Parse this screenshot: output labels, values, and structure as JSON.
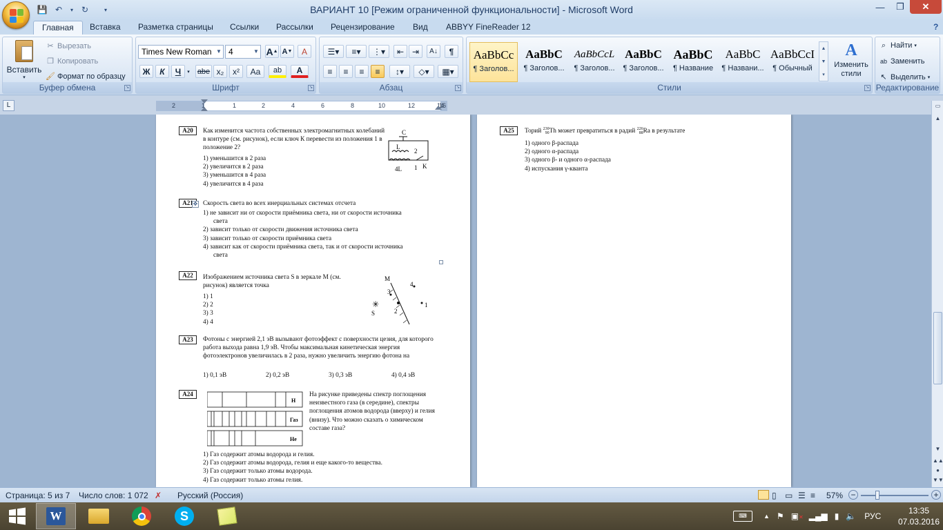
{
  "window": {
    "title": "ВАРИАНТ 10 [Режим ограниченной функциональности] - Microsoft Word",
    "minimize": "—",
    "maximize": "❐",
    "close": "✕",
    "help": "?"
  },
  "qat": [
    "💾",
    "↶",
    "▾",
    "↻",
    "▾"
  ],
  "tabs": [
    "Главная",
    "Вставка",
    "Разметка страницы",
    "Ссылки",
    "Рассылки",
    "Рецензирование",
    "Вид",
    "ABBYY FineReader 12"
  ],
  "ribbon": {
    "clipboard": {
      "label": "Буфер обмена",
      "paste": "Вставить",
      "cut": "Вырезать",
      "copy": "Копировать",
      "format_painter": "Формат по образцу"
    },
    "font": {
      "label": "Шрифт",
      "font_name": "Times New Roman",
      "font_size": "4",
      "grow": "A",
      "shrink": "A",
      "clear": "A",
      "bold": "Ж",
      "italic": "К",
      "underline": "Ч",
      "strike": "abe",
      "sub": "x₂",
      "sup": "x²",
      "case": "Aa",
      "highlight": "ab",
      "color": "A"
    },
    "paragraph": {
      "label": "Абзац"
    },
    "styles": {
      "label": "Стили",
      "change": "Изменить стили",
      "items": [
        {
          "preview": "AaBbCc",
          "name": "¶ Заголов..."
        },
        {
          "preview": "AaBbC",
          "name": "¶ Заголов..."
        },
        {
          "preview": "AaBbCcL",
          "name": "¶ Заголов..."
        },
        {
          "preview": "AaBbC",
          "name": "¶ Заголов..."
        },
        {
          "preview": "AaBbC",
          "name": "¶ Название"
        },
        {
          "preview": "AaBbC",
          "name": "¶ Названи..."
        },
        {
          "preview": "AaBbCcI",
          "name": "¶ Обычный"
        }
      ]
    },
    "editing": {
      "label": "Редактирование",
      "find": "Найти",
      "replace": "Заменить",
      "select": "Выделить"
    }
  },
  "ruler": {
    "corner": "L",
    "ticks": [
      "2",
      "1",
      "1",
      "2",
      "4",
      "6",
      "8",
      "10",
      "12",
      "14",
      "16"
    ]
  },
  "page1": {
    "a20": {
      "num": "A20",
      "text": "Как изменится частота собственных электромагнитных колебаний в контуре (см. рисунок), если ключ К перевести из положения 1 в положение 2?",
      "options": [
        "1)  уменьшится в 2 раза",
        "2)  увеличится в 2 раза",
        "3)  уменьшится в 4 раза",
        "4)  увеличится в 4 раза"
      ],
      "fig": {
        "c": "C",
        "l": "L",
        "l4": "4L",
        "p1": "1",
        "p2": "2",
        "k": "K"
      }
    },
    "a21": {
      "num": "A21",
      "text": "Скорость света во всех инерциальных системах отсчета",
      "options": [
        "1)  не зависит ни от скорости приёмника света, ни от скорости источника",
        "света",
        "2)  зависит только от скорости движения источника света",
        "3)  зависит только от скорости приёмника света",
        "4)  зависит как от скорости приёмника света, так и от скорости источника",
        "света"
      ]
    },
    "a22": {
      "num": "A22",
      "text": "Изображением источника света S в зеркале М (см. рисунок) является точка",
      "options": [
        "1)  1",
        "2)  2",
        "3)  3",
        "4)  4"
      ],
      "fig": {
        "m": "M",
        "s": "S",
        "p1": "1",
        "p2": "2",
        "p3": "3",
        "p4": "4"
      }
    },
    "a23": {
      "num": "A23",
      "text": "Фотоны с энергией 2,1 эВ вызывают фотоэффект с поверхности цезия, для которого работа выхода равна 1,9 эВ. Чтобы максимальная кинетическая энергия фотоэлектронов увеличилась в 2 раза, нужно увеличить энергию фотона на",
      "options": [
        "1)  0,1 эВ",
        "2)  0,2 эВ",
        "3)  0,3 эВ",
        "4)  0,4 эВ"
      ]
    },
    "a24": {
      "num": "A24",
      "text": "На рисунке приведены спектр поглощения неизвестного газа (в середине), спектры поглощения атомов водорода (вверху) и гелия (внизу). Что можно сказать о химическом составе газа?",
      "spectra": [
        "H",
        "Газ",
        "He"
      ],
      "options": [
        "1)  Газ содержит атомы водорода и гелия.",
        "2)  Газ содержит атомы водорода, гелия и еще какого-то вещества.",
        "3)  Газ содержит только атомы водорода.",
        "4)  Газ содержит только атомы гелия."
      ]
    }
  },
  "page2": {
    "a25": {
      "num": "A25",
      "text_pre": "Торий ",
      "th_mass": "230",
      "th_num": "90",
      "th": "Th",
      "text_mid": " может превратиться в радий ",
      "ra_mass": "226",
      "ra_num": "88",
      "ra": "Ra",
      "text_post": " в результате",
      "options": [
        "1)  одного β-распада",
        "2)  одного α-распада",
        "3)  одного β- и одного α-распада",
        "4)  испускания γ-кванта"
      ]
    }
  },
  "status": {
    "page": "Страница: 5 из 7",
    "words": "Число слов: 1 072",
    "lang": "Русский (Россия)",
    "zoom": "57%"
  },
  "taskbar": {
    "lang": "РУС",
    "time": "13:35",
    "date": "07.03.2016"
  },
  "colors": {
    "ribbon_accent": "#2b579a",
    "selected_style": "#fde39a",
    "taskbar": "#4a4331"
  }
}
